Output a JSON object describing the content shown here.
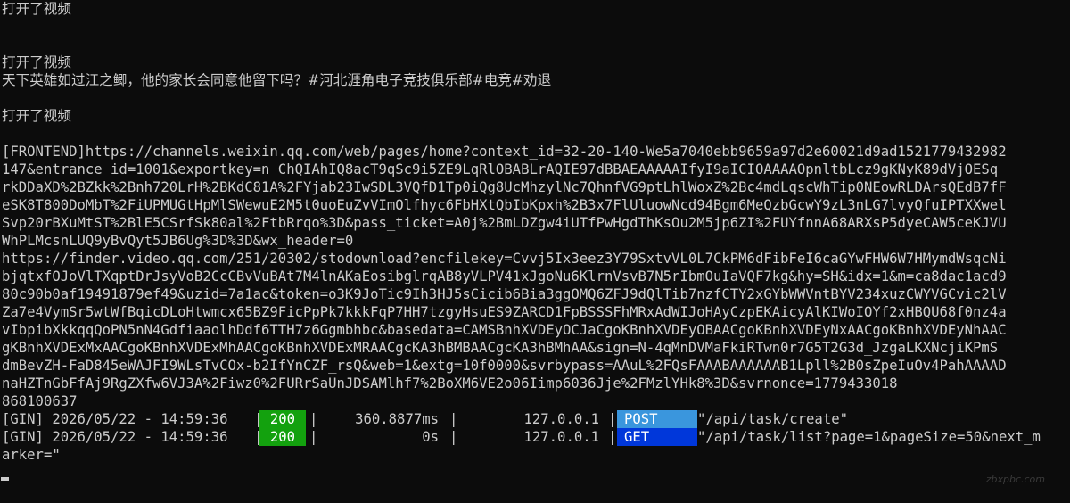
{
  "console": {
    "line_01": "打开了视频",
    "line_02": "",
    "line_03": "",
    "line_04": "打开了视频",
    "line_05": "天下英雄如过江之鲫，他的家长会同意他留下吗？#河北涯角电子竞技俱乐部#电竞#劝退",
    "line_06": "",
    "line_07": "打开了视频",
    "line_08": "",
    "line_09": "[FRONTEND]https://channels.weixin.qq.com/web/pages/home?context_id=32-20-140-We5a7040ebb9659a97d2e60021d9ad1521779432982",
    "line_10": "147&entrance_id=1001&exportkey=n_ChQIAhIQ8acT9qSc9i5ZE9LqRlOBABLrAQIE97dBBAEAAAAAIfyI9aICIOAAAAOpnltbLcz9gKNyK89dVjOESq",
    "line_11": "rkDDaXD%2BZkk%2Bnh720LrH%2BKdC81A%2FYjab23IwSDL3VQfD1Tp0iQg8UcMhzylNc7QhnfVG9ptLhlWoxZ%2Bc4mdLqscWhTip0NEowRLDArsQEdB7fF",
    "line_12": "eSK8T800DoMbT%2FiUPMUGtHpMlSWewuE2M5t0uoEuZvVImOlfhyc6FbHXtQbIbKpxh%2B3x7FlUluowNcd94Bgm6MeQzbGcwY9zL3nLG7lvyQfuIPTXXwel",
    "line_13": "Svp20rBXuMtST%2BlE5CSrfSk80al%2FtbRrqo%3D&pass_ticket=A0j%2BmLDZgw4iUTfPwHgdThKsOu2M5jp6ZI%2FUYfnnA68ARXsP5dyeCAW5ceKJVU",
    "line_14": "WhPLMcsnLUQ9yBvQyt5JB6Ug%3D%3D&wx_header=0",
    "line_15": "https://finder.video.qq.com/251/20302/stodownload?encfilekey=Cvvj5Ix3eez3Y79SxtvVL0L7CkPM6dFibFeI6caGYwFHW6W7HMymdWsqcNi",
    "line_16": "bjqtxfOJoVlTXqptDrJsyVoB2CcCBvVuBAt7M4lnAKaEosibglrqAB8yVLPV41xJgoNu6KlrnVsvB7N5rIbmOuIaVQF7kg&hy=SH&idx=1&m=ca8dac1acd9",
    "line_17": "80c90b0af19491879ef49&uzid=7a1ac&token=o3K9JoTic9Ih3HJ5sCicib6Bia3ggOMQ6ZFJ9dQlTib7nzfCTY2xGYbWWVntBYV234xuzCWYVGCvic2lV",
    "line_18": "Za7e4VymSr5wtWfBqicDLoHtwmcx65BZ9FicPpPk7kkkFqP7HH7tzgyHsuES9ZARCD1FpBSSSFhMRxAdWIJoHAyCzpEKAicyAlKIWoIOYf2xHBQU68f0nz4a",
    "line_19": "vIbpibXkkqqQoPN5nN4GdfiaaolhDdf6TTH7z6Ggmbhbc&basedata=CAMSBnhXVDEyOCJaCgoKBnhXVDEyOBAACgoKBnhXVDEyNxAACgoKBnhXVDEyNhAAC",
    "line_20": "gKBnhXVDExMxAACgoKBnhXVDExMhAACgoKBnhXVDExMRAACgcKA3hBMBAACgcKA3hBMhAA&sign=N-4qMnDVMaFkiRTwn0r7G5T2G3d_JzgaLKXNcjiKPmS",
    "line_21": "dmBevZH-FaD845eWAJFI9WLsTvCOx-b2IfYnCZF_rsQ&web=1&extg=10f0000&svrbypass=AAuL%2FQsFAAABAAAAAAB1Lpll%2B0sZpeIuOv4PahAAAAD",
    "line_22": "naHZTnGbFfAj9RgZXfw6VJ3A%2Fiwz0%2FURrSaUnJDSAMlhf7%2BoXM6VE2o06Iimp6036Jje%2FMzlYHk8%3D&svrnonce=1779433018",
    "line_23": "868100637"
  },
  "gin_rows": [
    {
      "prefix": "[GIN] 2026/05/22 - 14:59:36 ",
      "status": "200",
      "latency": "360.8877ms",
      "ip": "127.0.0.1",
      "method": "POST",
      "path": "\"/api/task/create\""
    },
    {
      "prefix": "[GIN] 2026/05/22 - 14:59:36 ",
      "status": "200",
      "latency": "0s",
      "ip": "127.0.0.1",
      "method": "GET",
      "path": "\"/api/task/list?page=1&pageSize=50&next_m"
    }
  ],
  "console_tail": {
    "line_26": "arker=\""
  },
  "colors": {
    "background": "#0c0c0c",
    "text": "#cccccc",
    "status_ok": "#13a10e",
    "method_post": "#3a96dd",
    "method_get": "#0037da"
  },
  "watermark": "zbxpbc.com"
}
